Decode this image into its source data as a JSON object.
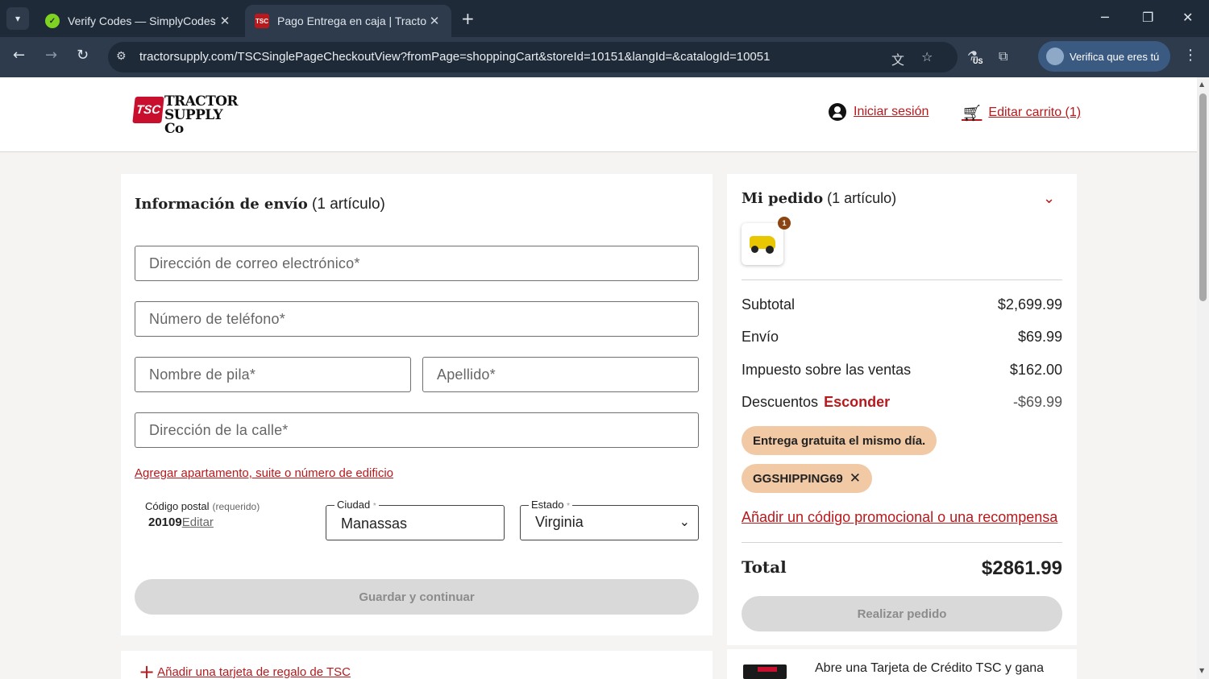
{
  "browser": {
    "tabs": [
      {
        "title": "Verify Codes — SimplyCodes",
        "favicon": "simplycodes-icon"
      },
      {
        "title": "Pago Entrega en caja | Tractor S",
        "favicon": "tsc-icon",
        "active": true
      }
    ],
    "url": "tractorsupply.com/TSCSinglePageCheckoutView?fromPage=shoppingCart&storeId=10151&langId=&catalogId=10051",
    "extension_badge": "US",
    "profile_label": "Verifica que eres tú",
    "tsc_favicon_text": "TSC",
    "accent": "#2d3b4c"
  },
  "header": {
    "logo_badge": "TSC",
    "logo_line1": "TRACTOR",
    "logo_line2": "SUPPLY Co",
    "signin": "Iniciar sesión",
    "cart": "Editar carrito (1)"
  },
  "shipping": {
    "title": "Información de envío",
    "count": "(1 artículo)",
    "email_placeholder": "Dirección de correo electrónico*",
    "phone_placeholder": "Número de teléfono*",
    "firstname_placeholder": "Nombre de pila*",
    "lastname_placeholder": "Apellido*",
    "street_placeholder": "Dirección de la calle*",
    "add_apartment": "Agregar apartamento, suite o número de edificio",
    "zip_label": "Código postal",
    "zip_required": "(requerido)",
    "zip_value": "20109",
    "zip_edit": "Editar",
    "city_label": "Ciudad",
    "city_value": "Manassas",
    "state_label": "Estado",
    "state_value": "Virginia",
    "required_mark": "*",
    "save_button": "Guardar y continuar",
    "gift_card": "Añadir una tarjeta de regalo de TSC"
  },
  "order": {
    "title": "Mi pedido",
    "count": "(1 artículo)",
    "item_qty": "1",
    "subtotal_label": "Subtotal",
    "subtotal_value": "$2,699.99",
    "shipping_label": "Envío",
    "shipping_value": "$69.99",
    "tax_label": "Impuesto sobre las ventas",
    "tax_value": "$162.00",
    "discounts_label": "Descuentos",
    "discounts_hide": "Esconder",
    "discounts_value": "-$69.99",
    "free_delivery_pill": "Entrega gratuita el mismo día.",
    "promo_code_pill": "GGSHIPPING69",
    "add_promo": "Añadir un código promocional o una recompensa",
    "total_label": "Total",
    "total_value": "$2861.99",
    "place_order": "Realizar pedido",
    "credit_card_text": "Abre una Tarjeta de Crédito TSC y gana"
  },
  "colors": {
    "brand_red": "#b8191c",
    "pill_bg": "#f1c9a5",
    "disabled_bg": "#d9d9d9"
  }
}
